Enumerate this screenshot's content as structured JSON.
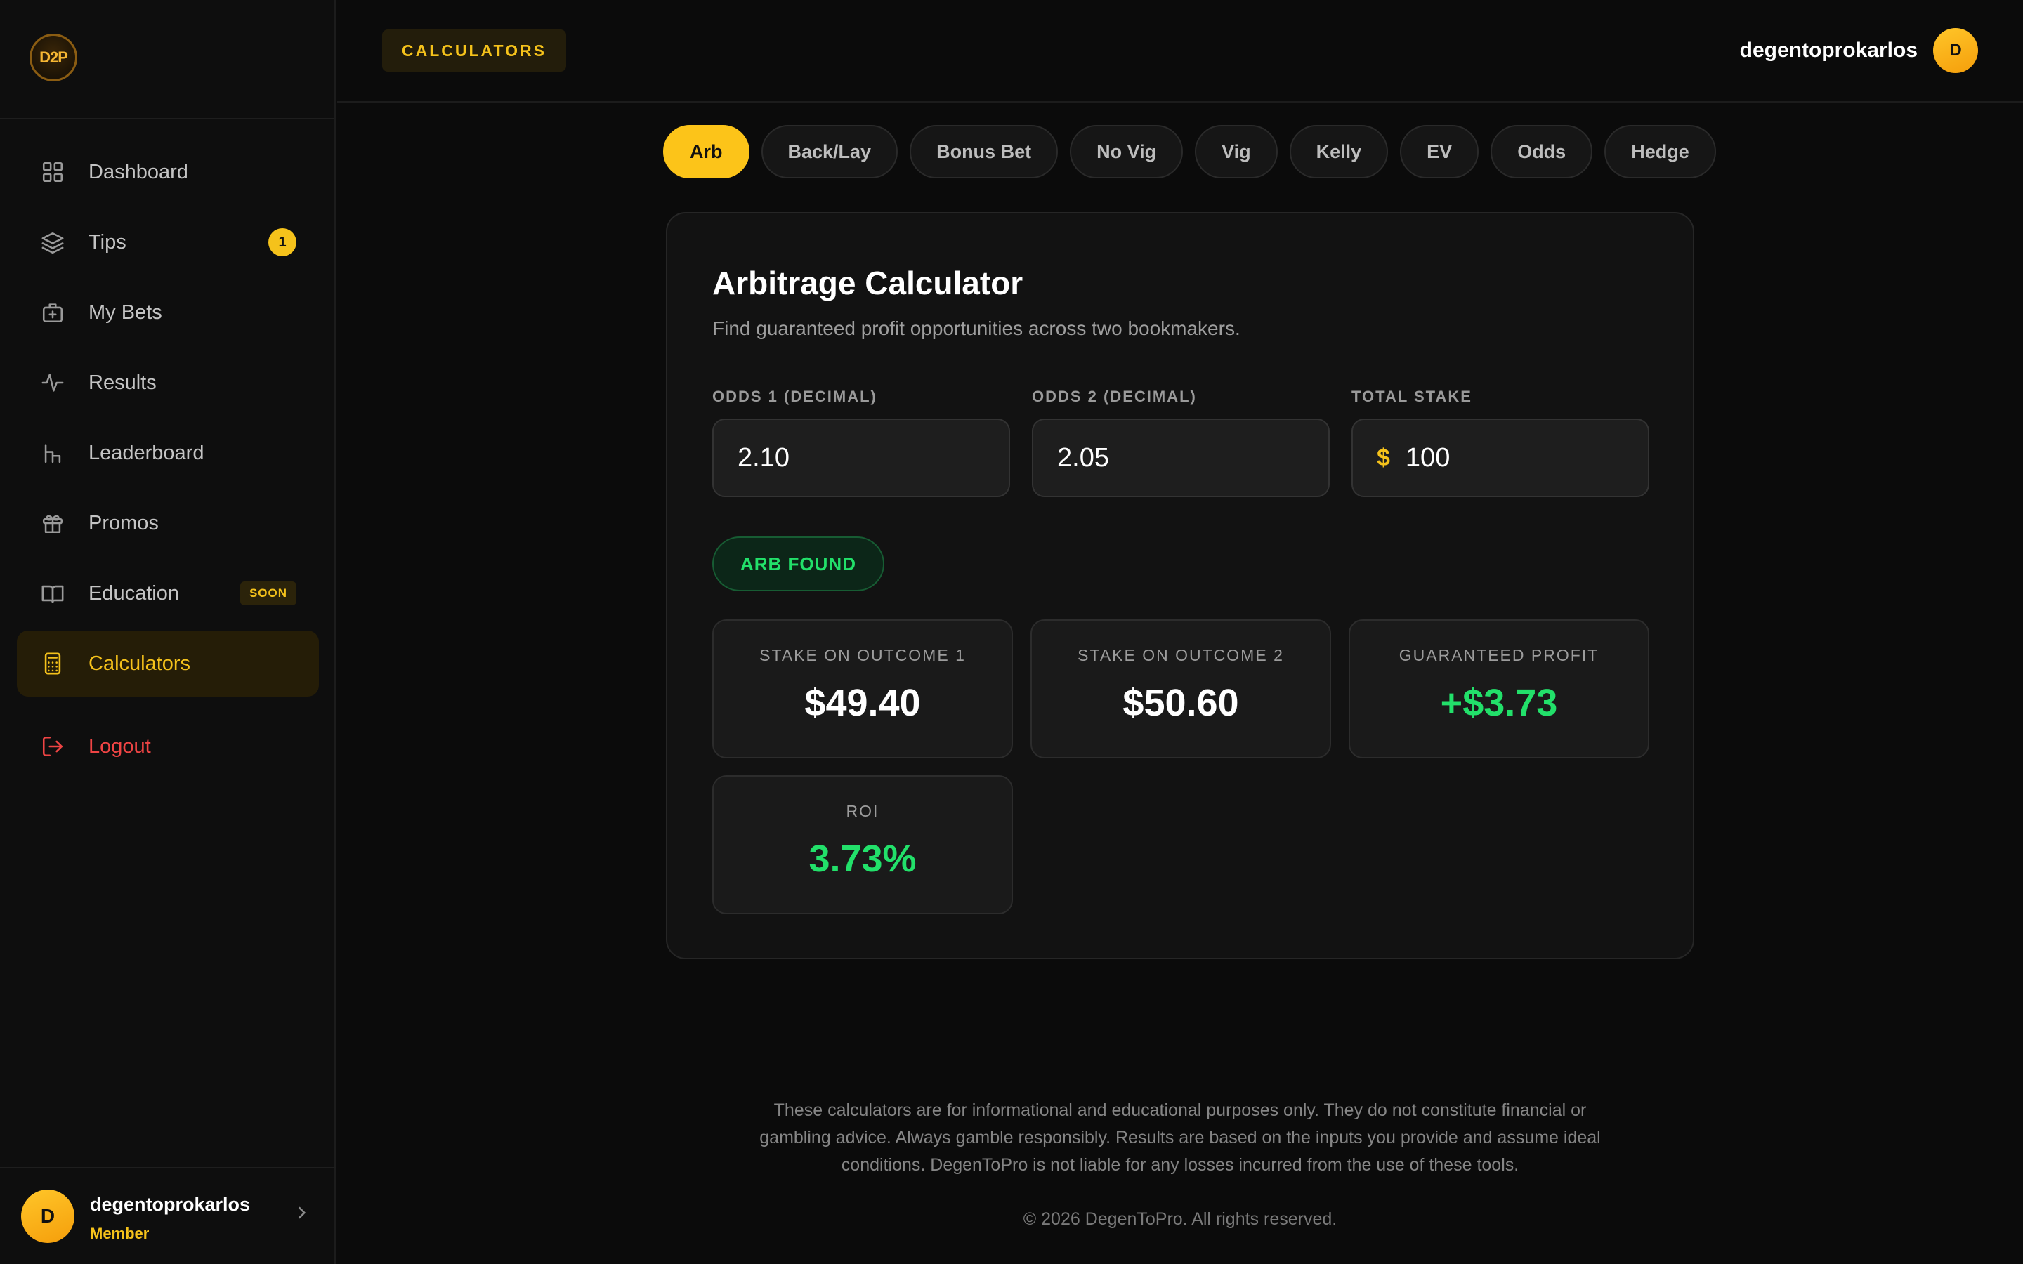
{
  "brand": {
    "logo_text": "D2P"
  },
  "sidebar": {
    "items": [
      {
        "label": "Dashboard",
        "icon": "grid-icon"
      },
      {
        "label": "Tips",
        "icon": "layers-icon",
        "badge": "1"
      },
      {
        "label": "My Bets",
        "icon": "briefcase-plus-icon"
      },
      {
        "label": "Results",
        "icon": "activity-icon"
      },
      {
        "label": "Leaderboard",
        "icon": "podium-icon"
      },
      {
        "label": "Promos",
        "icon": "gift-icon"
      },
      {
        "label": "Education",
        "icon": "book-icon",
        "badge": "SOON"
      },
      {
        "label": "Calculators",
        "icon": "calculator-icon",
        "active": true
      }
    ],
    "logout": {
      "label": "Logout",
      "icon": "logout-icon"
    },
    "user": {
      "avatar": "D",
      "name": "degentoprokarlos",
      "role": "Member"
    }
  },
  "header": {
    "section": "CALCULATORS",
    "user": {
      "name": "degentoprokarlos",
      "avatar": "D"
    }
  },
  "tabs": [
    "Arb",
    "Back/Lay",
    "Bonus Bet",
    "No Vig",
    "Vig",
    "Kelly",
    "EV",
    "Odds",
    "Hedge"
  ],
  "active_tab": "Arb",
  "calculator": {
    "title": "Arbitrage Calculator",
    "subtitle": "Find guaranteed profit opportunities across two bookmakers.",
    "fields": {
      "odds1": {
        "label": "ODDS 1 (DECIMAL)",
        "value": "2.10"
      },
      "odds2": {
        "label": "ODDS 2 (DECIMAL)",
        "value": "2.05"
      },
      "stake": {
        "label": "TOTAL STAKE",
        "currency": "$",
        "value": "100"
      }
    },
    "status": "ARB FOUND",
    "results": {
      "stake1": {
        "label": "STAKE ON OUTCOME 1",
        "value": "$49.40"
      },
      "stake2": {
        "label": "STAKE ON OUTCOME 2",
        "value": "$50.60"
      },
      "profit": {
        "label": "GUARANTEED PROFIT",
        "value": "+$3.73"
      },
      "roi": {
        "label": "ROI",
        "value": "3.73%"
      }
    }
  },
  "footer": {
    "disclaimer": "These calculators are for informational and educational purposes only. They do not constitute financial or gambling advice. Always gamble responsibly. Results are based on the inputs you provide and assume ideal conditions. DegenToPro is not liable for any losses incurred from the use of these tools.",
    "copyright": "© 2026 DegenToPro. All rights reserved."
  },
  "colors": {
    "accent": "#f5c21b",
    "success": "#22e06a",
    "danger": "#ef4444",
    "background": "#0b0b0b",
    "card": "#121212"
  }
}
